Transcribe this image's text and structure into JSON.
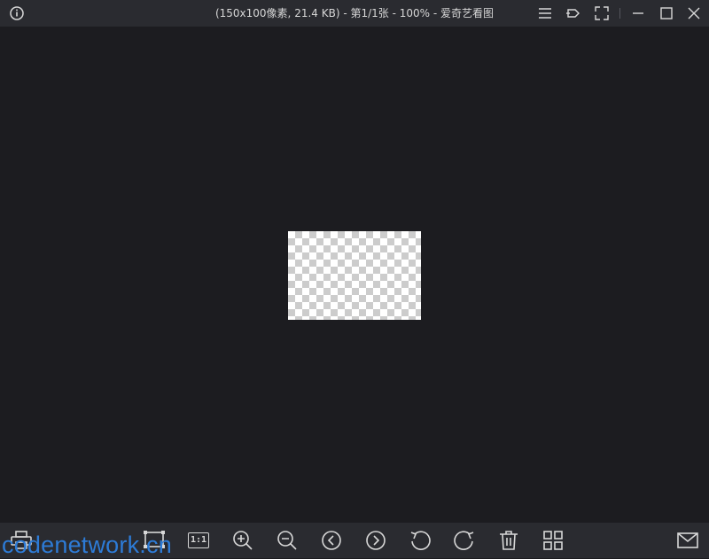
{
  "window": {
    "title": "(150x100像素, 21.4 KB) - 第1/1张 - 100% - 爱奇艺看图"
  },
  "titlebar_icons": [
    "info-icon",
    "menu-icon",
    "pin-icon",
    "fullscreen-icon",
    "minimize-icon",
    "maximize-icon",
    "close-icon"
  ],
  "toolbar": {
    "actual_size_label": "1:1",
    "icons": [
      "print-icon",
      "crop-icon",
      "actual-size-icon",
      "zoom-in-icon",
      "zoom-out-icon",
      "previous-icon",
      "next-icon",
      "rotate-left-icon",
      "rotate-right-icon",
      "delete-icon",
      "grid-view-icon",
      "mail-icon"
    ]
  },
  "watermark": {
    "text": "codenetwork.cn"
  },
  "colors": {
    "background": "#1c1c20",
    "bar": "#2a2b30",
    "icon": "#d8d8d8",
    "watermark": "#2d7bd6"
  }
}
